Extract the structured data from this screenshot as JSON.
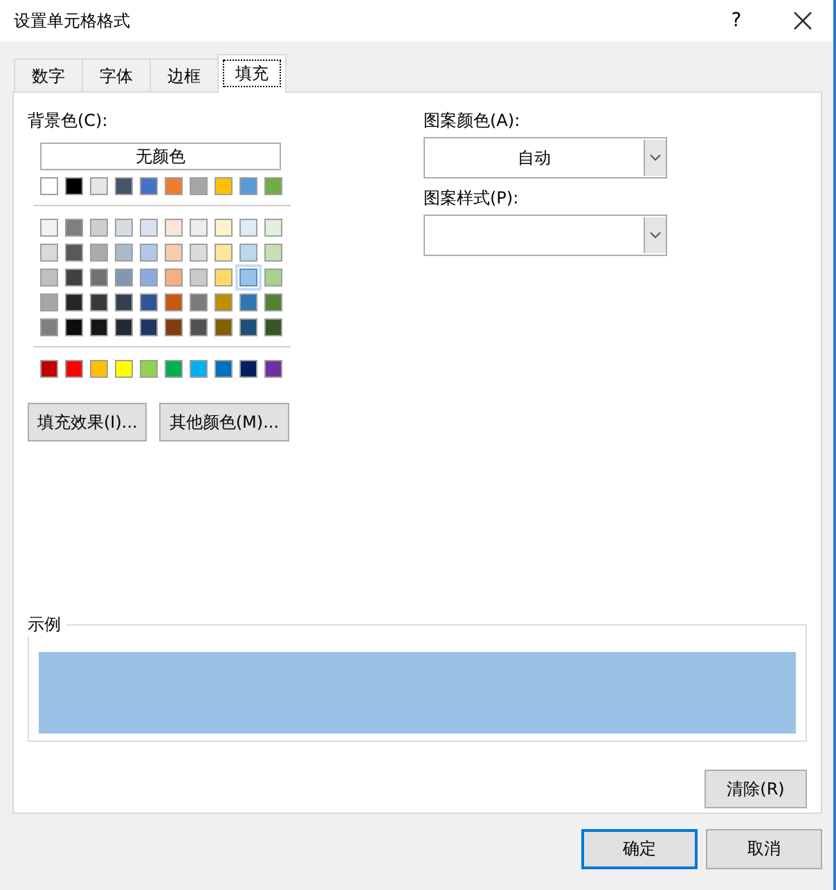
{
  "window": {
    "title": "设置单元格格式",
    "help": "?"
  },
  "tabs": [
    {
      "label": "数字",
      "selected": false
    },
    {
      "label": "字体",
      "selected": false
    },
    {
      "label": "边框",
      "selected": false
    },
    {
      "label": "填充",
      "selected": true
    }
  ],
  "background": {
    "label": "背景色(C):",
    "no_color_button": "无颜色",
    "theme_row": [
      {
        "color": "#ffffff",
        "selected": false
      },
      {
        "color": "#000000",
        "selected": false
      },
      {
        "color": "#e7e6e6",
        "selected": false
      },
      {
        "color": "#44546a",
        "selected": false
      },
      {
        "color": "#4472c4",
        "selected": false
      },
      {
        "color": "#ed7d31",
        "selected": false
      },
      {
        "color": "#a5a5a5",
        "selected": false
      },
      {
        "color": "#ffc000",
        "selected": false
      },
      {
        "color": "#5b9bd5",
        "selected": false
      },
      {
        "color": "#70ad47",
        "selected": false
      }
    ],
    "tint_rows": [
      [
        {
          "color": "#f2f2f2",
          "selected": false
        },
        {
          "color": "#7f7f7f",
          "selected": false
        },
        {
          "color": "#d0cece",
          "selected": false
        },
        {
          "color": "#d6dce4",
          "selected": false
        },
        {
          "color": "#d9e1f2",
          "selected": false
        },
        {
          "color": "#fce4d6",
          "selected": false
        },
        {
          "color": "#ededed",
          "selected": false
        },
        {
          "color": "#fff2cc",
          "selected": false
        },
        {
          "color": "#ddebf7",
          "selected": false
        },
        {
          "color": "#e2efda",
          "selected": false
        }
      ],
      [
        {
          "color": "#d9d9d9",
          "selected": false
        },
        {
          "color": "#595959",
          "selected": false
        },
        {
          "color": "#aeaaaa",
          "selected": false
        },
        {
          "color": "#acb9ca",
          "selected": false
        },
        {
          "color": "#b4c6e7",
          "selected": false
        },
        {
          "color": "#f8cbad",
          "selected": false
        },
        {
          "color": "#dbdbdb",
          "selected": false
        },
        {
          "color": "#ffe699",
          "selected": false
        },
        {
          "color": "#bdd7ee",
          "selected": false
        },
        {
          "color": "#c6e0b4",
          "selected": false
        }
      ],
      [
        {
          "color": "#bfbfbf",
          "selected": false
        },
        {
          "color": "#404040",
          "selected": false
        },
        {
          "color": "#757171",
          "selected": false
        },
        {
          "color": "#8497b0",
          "selected": false
        },
        {
          "color": "#8ea9db",
          "selected": false
        },
        {
          "color": "#f4b084",
          "selected": false
        },
        {
          "color": "#c9c9c9",
          "selected": false
        },
        {
          "color": "#ffd966",
          "selected": false
        },
        {
          "color": "#9bc2e6",
          "selected": true
        },
        {
          "color": "#a9d08e",
          "selected": false
        }
      ],
      [
        {
          "color": "#a6a6a6",
          "selected": false
        },
        {
          "color": "#262626",
          "selected": false
        },
        {
          "color": "#3a3838",
          "selected": false
        },
        {
          "color": "#333f4f",
          "selected": false
        },
        {
          "color": "#2f5496",
          "selected": false
        },
        {
          "color": "#c65911",
          "selected": false
        },
        {
          "color": "#7b7b7b",
          "selected": false
        },
        {
          "color": "#bf8f00",
          "selected": false
        },
        {
          "color": "#2f75b5",
          "selected": false
        },
        {
          "color": "#548235",
          "selected": false
        }
      ],
      [
        {
          "color": "#808080",
          "selected": false
        },
        {
          "color": "#0d0d0d",
          "selected": false
        },
        {
          "color": "#161616",
          "selected": false
        },
        {
          "color": "#222b35",
          "selected": false
        },
        {
          "color": "#203764",
          "selected": false
        },
        {
          "color": "#833c0c",
          "selected": false
        },
        {
          "color": "#525252",
          "selected": false
        },
        {
          "color": "#806000",
          "selected": false
        },
        {
          "color": "#1f4e78",
          "selected": false
        },
        {
          "color": "#375623",
          "selected": false
        }
      ]
    ],
    "standard_row": [
      {
        "color": "#c00000",
        "selected": false
      },
      {
        "color": "#ff0000",
        "selected": false
      },
      {
        "color": "#ffc000",
        "selected": false
      },
      {
        "color": "#ffff00",
        "selected": false
      },
      {
        "color": "#92d050",
        "selected": false
      },
      {
        "color": "#00b050",
        "selected": false
      },
      {
        "color": "#00b0f0",
        "selected": false
      },
      {
        "color": "#0070c0",
        "selected": false
      },
      {
        "color": "#002060",
        "selected": false
      },
      {
        "color": "#7030a0",
        "selected": false
      }
    ],
    "buttons": [
      "填充效果(I)...",
      "其他颜色(M)..."
    ]
  },
  "pattern_color": {
    "label": "图案颜色(A):",
    "value": "自动"
  },
  "pattern_style": {
    "label": "图案样式(P):"
  },
  "sample": {
    "label": "示例",
    "color": "#9bc2e6"
  },
  "clear_button": "清除(R)",
  "footer_buttons": [
    {
      "label": "确定",
      "default": true
    },
    {
      "label": "取消",
      "default": false
    }
  ]
}
